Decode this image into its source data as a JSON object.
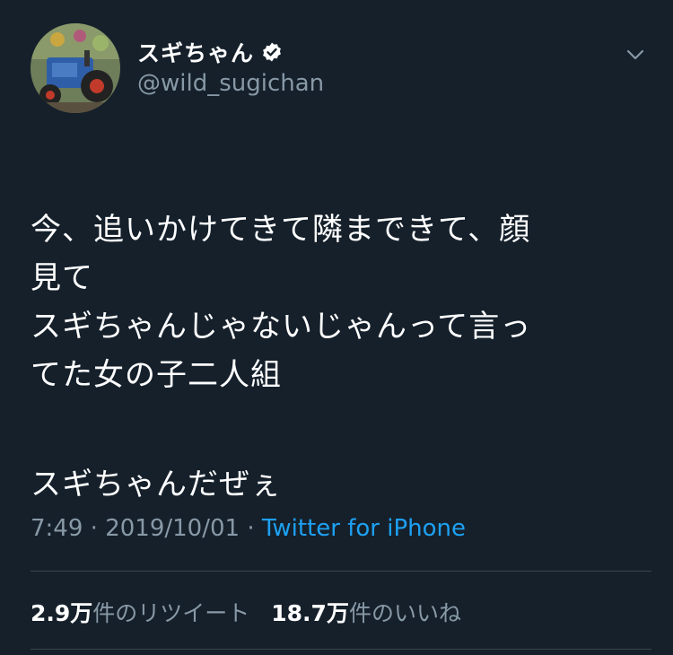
{
  "tweet": {
    "author": {
      "display_name": "スギちゃん",
      "handle": "@wild_sugichan",
      "verified": true,
      "avatar_icon": "tractor-photo-avatar"
    },
    "menu_icon": "chevron-down-icon",
    "paragraphs": [
      "今、追いかけてきて隣まできて、顔\n見て\nスギちゃんじゃないじゃんって言っ\nてた女の子二人組",
      "スギちゃんだぜぇ"
    ],
    "time": "7:49",
    "date": "2019/10/01",
    "separator": "·",
    "source": "Twitter for iPhone",
    "retweets": {
      "count": "2.9万",
      "label": "件のリツイート"
    },
    "likes": {
      "count": "18.7万",
      "label": "件のいいね"
    }
  },
  "colors": {
    "background": "#15202b",
    "text": "#ffffff",
    "secondary": "#8899a6",
    "link": "#1da1f2",
    "divider": "#38444d"
  }
}
